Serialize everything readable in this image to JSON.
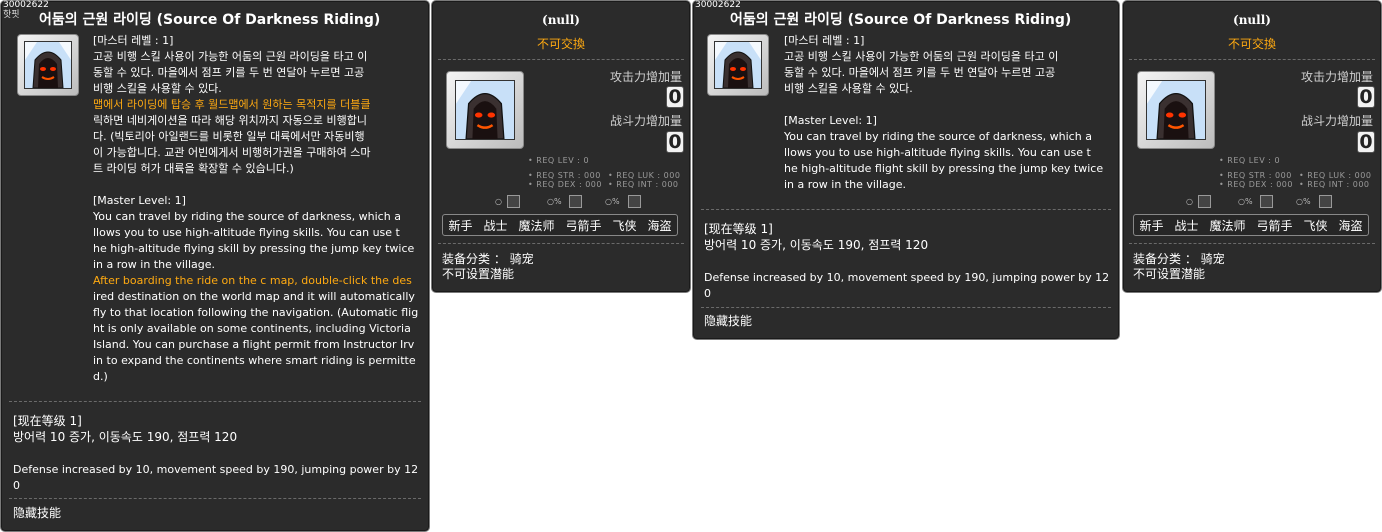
{
  "panel1": {
    "item_id": "30002622",
    "id_sub": "핫핏",
    "title": "어둠의 근원 라이딩 (Source Of Darkness Riding)",
    "kr_lines": [
      {
        "text": "[마스터 레벨 : 1]",
        "color": "#ffffff"
      },
      {
        "text": "고공 비행 스킬 사용이 가능한 어둠의 근원 라이딩을 타고 이",
        "color": "#ffffff"
      },
      {
        "text": "동할 수 있다. 마을에서 점프 키를 두 번 연달아 누르면 고공",
        "color": "#ffffff"
      },
      {
        "text": "비행 스킬을 사용할 수 있다.",
        "color": "#ffffff"
      },
      {
        "text": "맵에서 라이딩에 탑승 후 월드맵에서 원하는 목적지를 더블클",
        "color": "#ffaa11"
      },
      {
        "text": "릭하면 네비게이션을 따라 해당 위치까지 자동으로 비행합니",
        "color": "#ffffff"
      },
      {
        "text": "다. (빅토리아 아일랜드를 비롯한 일부 대륙에서만 자동비행",
        "color": "#ffffff"
      },
      {
        "text": "이 가능합니다. 교관 어빈에게서 비행허가권을 구매하여 스마",
        "color": "#ffffff"
      },
      {
        "text": "트 라이딩 허가 대륙을 확장할 수 있습니다.)",
        "color": "#ffffff"
      }
    ],
    "en_lines": [
      {
        "text": "[Master Level: 1]",
        "color": "#ffffff"
      },
      {
        "text": "You can travel by riding the source of darkness, which a",
        "color": "#ffffff"
      },
      {
        "text": "llows you to use high-altitude flying skills. You can use t",
        "color": "#ffffff"
      },
      {
        "text": "he high-altitude flying skill by pressing the jump key twice",
        "color": "#ffffff"
      },
      {
        "text": "in a row in the village.",
        "color": "#ffffff"
      },
      {
        "text": "After boarding the ride on the c map, double-click the des",
        "color": "#ffaa11"
      },
      {
        "text": "ired destination on the world map and it will automatically",
        "color": "#ffffff"
      },
      {
        "text": "fly to that location following the navigation. (Automatic flig",
        "color": "#ffffff"
      },
      {
        "text": "ht is only available on some continents, including Victoria",
        "color": "#ffffff"
      },
      {
        "text": "Island. You can purchase a flight permit from Instructor Irv",
        "color": "#ffffff"
      },
      {
        "text": "in to expand the continents where smart riding is permitte",
        "color": "#ffffff"
      },
      {
        "text": "d.)",
        "color": "#ffffff"
      }
    ],
    "current_level": "[现在等级 1]",
    "effect_kr": "방어력 10 증가, 이동속도 190, 점프력 120",
    "effect_en_1": "Defense increased by 10, movement speed by 190, jumping power by 12",
    "effect_en_2": "0",
    "hidden_skill": "隐藏技能"
  },
  "panel2": {
    "title": "(null)",
    "trade": "不可交換",
    "attack_label": "攻击力增加量",
    "attack_value": "0",
    "power_label": "战斗力增加量",
    "power_value": "0",
    "req_lev": "• REQ LEV :      0",
    "req_str": "• REQ STR : 000",
    "req_luk": "• REQ LUK : 000",
    "req_dex": "• REQ DEX : 000",
    "req_int": "• REQ INT : 000",
    "jobs": [
      "新手",
      "战士",
      "魔法师",
      "弓箭手",
      "飞侠",
      "海盗"
    ],
    "category": "装备分类 ： 骑宠",
    "potential": "不可设置潜能"
  },
  "panel3": {
    "item_id": "30002622",
    "title": "어둠의 근원 라이딩 (Source Of Darkness Riding)",
    "kr_lines": [
      "[마스터 레벨 : 1]",
      "고공 비행 스킬 사용이 가능한 어둠의 근원 라이딩을 타고 이",
      "동할 수 있다. 마을에서 점프 키를 두 번 연달아 누르면 고공",
      "비행 스킬을 사용할 수 있다."
    ],
    "en_lines": [
      "[Master Level: 1]",
      "You can travel by riding the source of darkness, which a",
      "llows you to use high-altitude flying skills. You can use t",
      "he high-altitude flight skill by pressing the jump key twice",
      "in a row in the village."
    ],
    "current_level": "[现在等级 1]",
    "effect_kr": "방어력 10 증가, 이동속도 190, 점프력 120",
    "effect_en_1": "Defense increased by 10, movement speed by 190, jumping power by 12",
    "effect_en_2": "0",
    "hidden_skill": "隐藏技能"
  },
  "panel4": {
    "title": "(null)",
    "trade": "不可交換",
    "attack_label": "攻击力增加量",
    "attack_value": "0",
    "power_label": "战斗力增加量",
    "power_value": "0",
    "req_lev": "• REQ LEV :      0",
    "req_str": "• REQ STR : 000",
    "req_luk": "• REQ LUK : 000",
    "req_dex": "• REQ DEX : 000",
    "req_int": "• REQ INT : 000",
    "jobs": [
      "新手",
      "战士",
      "魔法师",
      "弓箭手",
      "飞侠",
      "海盗"
    ],
    "category": "装备分类 ： 骑宠",
    "potential": "不可设置潜能"
  },
  "colors": {
    "panel_bg": "#2b2b2b",
    "accent": "#ffaa11",
    "border": "#7a7a7a"
  },
  "icons": [
    "darkness-riding-icon",
    "item-icon",
    "helmet-icon",
    "shield-icon"
  ]
}
